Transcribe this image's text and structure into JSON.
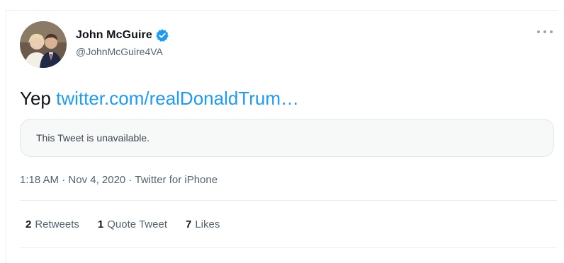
{
  "author": {
    "display_name": "John McGuire",
    "handle": "@JohnMcGuire4VA",
    "verified_icon": "verified-badge-icon",
    "avatar": "profile-photo"
  },
  "tweet": {
    "text_prefix": "Yep",
    "link_text": "twitter.com/realDonaldTrum…",
    "quoted_tweet_notice": "This Tweet is unavailable."
  },
  "meta": {
    "time": "1:18 AM",
    "separator": "·",
    "date": "Nov 4, 2020",
    "source": "Twitter for iPhone"
  },
  "stats": [
    {
      "count": "2",
      "label": "Retweets"
    },
    {
      "count": "1",
      "label": "Quote Tweet"
    },
    {
      "count": "7",
      "label": "Likes"
    }
  ],
  "colors": {
    "link": "#1d9bf0",
    "verified": "#1d9bf0",
    "secondary_text": "#536471",
    "primary_text": "#0f1419",
    "quote_card_bg": "#f7f9f9"
  }
}
